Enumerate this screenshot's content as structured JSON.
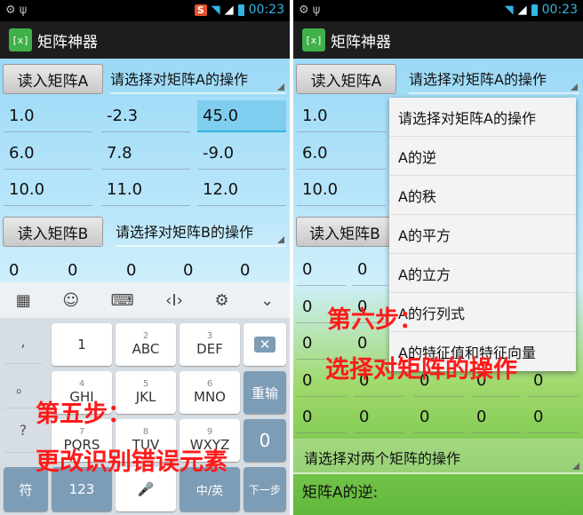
{
  "status": {
    "time": "00:23",
    "s_badge": "S"
  },
  "app": {
    "title": "矩阵神器",
    "icon_text": "[x]"
  },
  "matrixA": {
    "read_button": "读入矩阵A",
    "spinner": "请选择对矩阵A的操作",
    "cells": [
      [
        "1.0",
        "-2.3",
        "45.0"
      ],
      [
        "6.0",
        "7.8",
        "-9.0"
      ],
      [
        "10.0",
        "11.0",
        "12.0"
      ]
    ]
  },
  "matrixB": {
    "read_button": "读入矩阵B",
    "spinner": "请选择对矩阵B的操作",
    "row_left": [
      "0",
      "0",
      "0",
      "0",
      "0"
    ],
    "right_rows": [
      [
        "0",
        "0"
      ],
      [
        "0",
        "0"
      ],
      [
        "0",
        "0"
      ],
      [
        "0",
        "0",
        "0",
        "0",
        "0"
      ],
      [
        "0",
        "0",
        "0",
        "0",
        "0"
      ]
    ]
  },
  "keyboard": {
    "side_keys": [
      ",",
      "。",
      "?",
      "!"
    ],
    "keys": {
      "k1": {
        "main": "1",
        "num": ""
      },
      "k2": {
        "main": "ABC",
        "num": "2"
      },
      "k3": {
        "main": "DEF",
        "num": "3"
      },
      "k4": {
        "main": "GHI",
        "num": "4"
      },
      "k5": {
        "main": "JKL",
        "num": "5"
      },
      "k6": {
        "main": "MNO",
        "num": "6"
      },
      "k7": {
        "main": "PQRS",
        "num": "7"
      },
      "k8": {
        "main": "TUV",
        "num": "8"
      },
      "k9": {
        "main": "WXYZ",
        "num": "9"
      },
      "k0": {
        "main": "0"
      }
    },
    "reenter": "重输",
    "symbol": "符",
    "num123": "123",
    "lang": "中/英",
    "next": "下一步"
  },
  "menu": {
    "items": [
      "请选择对矩阵A的操作",
      "A的逆",
      "A的秩",
      "A的平方",
      "A的立方",
      "A的行列式",
      "A的特征值和特征向量"
    ]
  },
  "bottom": {
    "two_matrix_spinner": "请选择对两个矩阵的操作",
    "result_label": "矩阵A的逆:"
  },
  "annotations": {
    "step5_title": "第五步：",
    "step5_desc": "更改识别错误元素",
    "step6_title": "第六步：",
    "step6_desc": "选择对矩阵的操作"
  },
  "colors": {
    "annotation": "#ff1a1a",
    "accent": "#33b5e5",
    "app_icon": "#3fb04a"
  }
}
